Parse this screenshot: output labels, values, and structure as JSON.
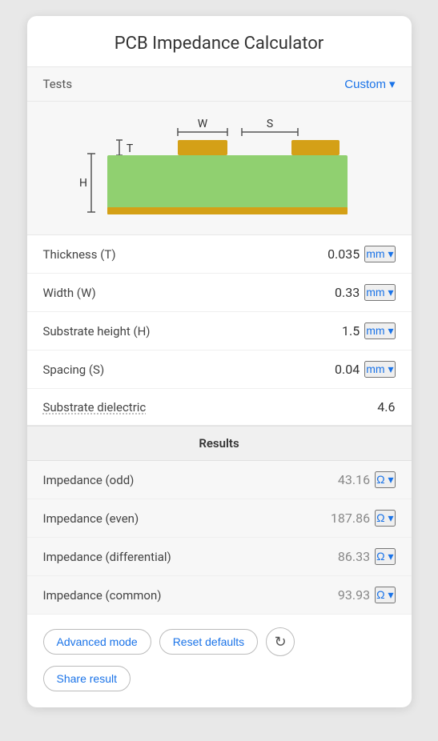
{
  "app": {
    "title": "PCB Impedance Calculator"
  },
  "header": {
    "tests_label": "Tests",
    "tests_value": "Custom",
    "tests_dropdown_arrow": "▾"
  },
  "diagram": {
    "w_label": "W",
    "s_label": "S",
    "t_label": "T",
    "h_label": "H"
  },
  "params": [
    {
      "label": "Thickness (T)",
      "value": "0.035",
      "unit": "mm",
      "has_dropdown": true
    },
    {
      "label": "Width (W)",
      "value": "0.33",
      "unit": "mm",
      "has_dropdown": true
    },
    {
      "label": "Substrate height (H)",
      "value": "1.5",
      "unit": "mm",
      "has_dropdown": true
    },
    {
      "label": "Spacing (S)",
      "value": "0.04",
      "unit": "mm",
      "has_dropdown": true
    },
    {
      "label": "Substrate dielectric",
      "value": "4.6",
      "unit": "",
      "has_dropdown": false
    }
  ],
  "results_header": "Results",
  "results": [
    {
      "label": "Impedance (odd)",
      "value": "43.16",
      "unit": "Ω"
    },
    {
      "label": "Impedance (even)",
      "value": "187.86",
      "unit": "Ω"
    },
    {
      "label": "Impedance (differential)",
      "value": "86.33",
      "unit": "Ω"
    },
    {
      "label": "Impedance (common)",
      "value": "93.93",
      "unit": "Ω"
    }
  ],
  "buttons": {
    "advanced_mode": "Advanced mode",
    "reset_defaults": "Reset defaults",
    "share_result": "Share result"
  }
}
